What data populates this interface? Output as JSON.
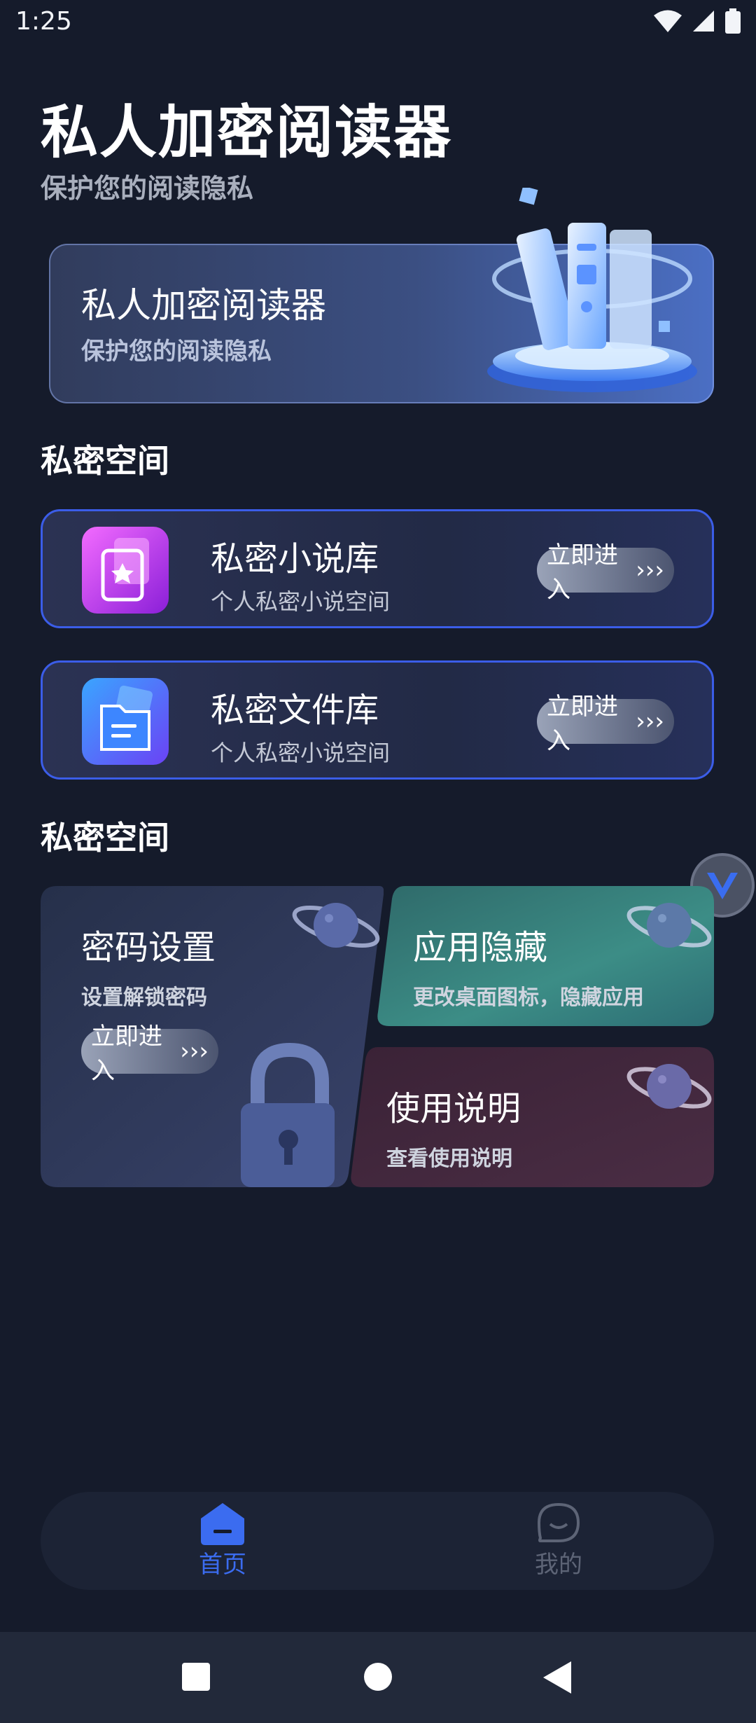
{
  "status_bar": {
    "time": "1:25",
    "icons": [
      "wifi-icon",
      "signal-icon",
      "battery-icon"
    ]
  },
  "header": {
    "title": "私人加密阅读器",
    "subtitle": "保护您的阅读隐私"
  },
  "banner": {
    "title": "私人加密阅读器",
    "subtitle": "保护您的阅读隐私"
  },
  "section1": {
    "title": "私密空间"
  },
  "cards": [
    {
      "title": "私密小说库",
      "subtitle": "个人私密小说空间",
      "button": "立即进入",
      "icon": "novel-library-icon"
    },
    {
      "title": "私密文件库",
      "subtitle": "个人私密小说空间",
      "button": "立即进入",
      "icon": "file-library-icon"
    }
  ],
  "section2": {
    "title": "私密空间"
  },
  "tiles": {
    "password": {
      "title": "密码设置",
      "subtitle": "设置解锁密码",
      "button": "立即进入"
    },
    "hide": {
      "title": "应用隐藏",
      "subtitle": "更改桌面图标，隐藏应用"
    },
    "guide": {
      "title": "使用说明",
      "subtitle": "查看使用说明"
    }
  },
  "bottom_nav": {
    "items": [
      {
        "label": "首页",
        "icon": "home-icon",
        "active": true
      },
      {
        "label": "我的",
        "icon": "profile-icon",
        "active": false
      }
    ]
  },
  "colors": {
    "background": "#151b2b",
    "accent": "#3b6cf0",
    "card_border": "#3b5de8"
  }
}
